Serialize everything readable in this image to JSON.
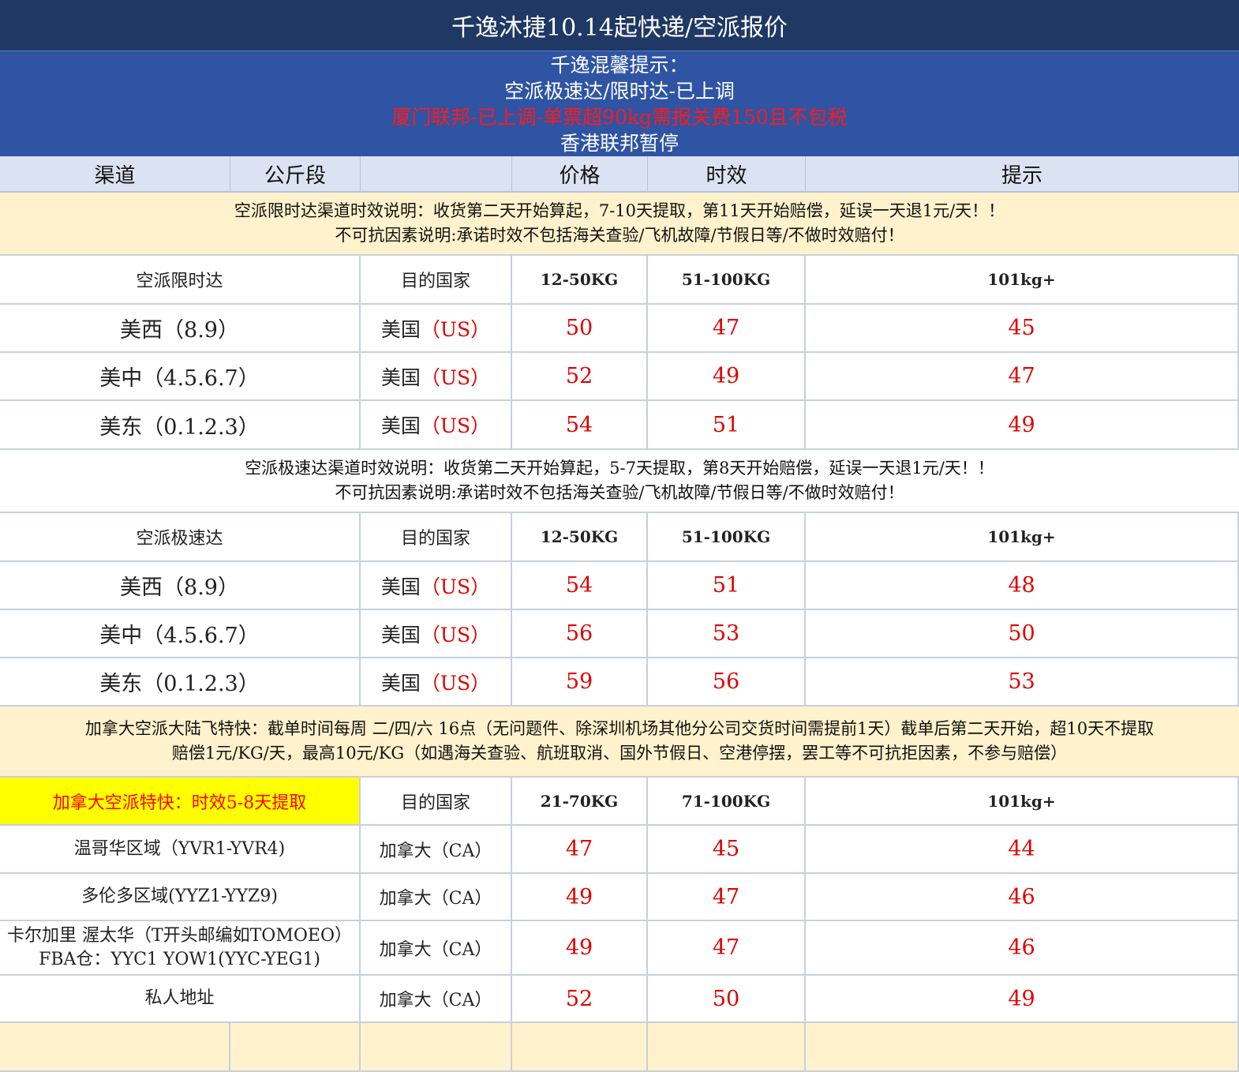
{
  "title": "千逸沐捷10.14起快递/空派报价",
  "notice": {
    "line1": "千逸混馨提示：",
    "line2": "空派极速达/限时达-已上调",
    "line3": "厦门联邦-已上调-单票超90kg需报关费150且不包税",
    "line4": "香港联邦暂停",
    "alert_color": "#ff1a1a"
  },
  "header": {
    "channel": "渠道",
    "weight": "公斤段",
    "price": "价格",
    "timeliness": "时效",
    "tips": "提示"
  },
  "sections": [
    {
      "note1": "空派限时达渠道时效说明：收货第二天开始算起，7-10天提取，第11天开始赔偿，延误一天退1元/天！！",
      "note2": "不可抗因素说明:承诺时效不包括海关查验/飞机故障/节假日等/不做时效赔付！",
      "sub": [
        "空派限时达",
        "目的国家",
        "12-50KG",
        "51-100KG",
        "101kg+"
      ],
      "rows": [
        {
          "name": "美西（8.9）",
          "country": "美国",
          "code": "（US）",
          "p1": "50",
          "p2": "47",
          "p3": "45"
        },
        {
          "name": "美中（4.5.6.7）",
          "country": "美国",
          "code": "（US）",
          "p1": "52",
          "p2": "49",
          "p3": "47"
        },
        {
          "name": "美东（0.1.2.3）",
          "country": "美国",
          "code": "（US）",
          "p1": "54",
          "p2": "51",
          "p3": "49"
        }
      ]
    },
    {
      "note1": "空派极速达渠道时效说明：收货第二天开始算起，5-7天提取，第8天开始赔偿，延误一天退1元/天！！",
      "note2": "不可抗因素说明:承诺时效不包括海关查验/飞机故障/节假日等/不做时效赔付！",
      "sub": [
        "空派极速达",
        "目的国家",
        "12-50KG",
        "51-100KG",
        "101kg+"
      ],
      "rows": [
        {
          "name": "美西（8.9）",
          "country": "美国",
          "code": "（US）",
          "p1": "54",
          "p2": "51",
          "p3": "48"
        },
        {
          "name": "美中（4.5.6.7）",
          "country": "美国",
          "code": "（US）",
          "p1": "56",
          "p2": "53",
          "p3": "50"
        },
        {
          "name": "美东（0.1.2.3）",
          "country": "美国",
          "code": "（US）",
          "p1": "59",
          "p2": "56",
          "p3": "53"
        }
      ]
    },
    {
      "note1": "加拿大空派大陆飞特快：截单时间每周 二/四/六 16点（无问题件、除深圳机场其他分公司交货时间需提前1天）截单后第二天开始，超10天不提取",
      "note2": "赔偿1元/KG/天，最高10元/KG（如遇海关查验、航班取消、国外节假日、空港停摆，罢工等不可抗拒因素，不参与赔偿）",
      "sub": [
        "加拿大空派特快：时效5-8天提取",
        "目的国家",
        "21-70KG",
        "71-100KG",
        "101kg+"
      ],
      "rows": [
        {
          "name": "温哥华区域（YVR1-YVR4)",
          "name2": "",
          "country": "加拿大（CA）",
          "p1": "47",
          "p2": "45",
          "p3": "44"
        },
        {
          "name": "多伦多区域(YYZ1-YYZ9)",
          "name2": "",
          "country": "加拿大（CA）",
          "p1": "49",
          "p2": "47",
          "p3": "46"
        },
        {
          "name": "卡尔加里 渥太华（T开头邮编如TOMOEO）",
          "name2": "FBA仓：YYC1 YOW1(YYC-YEG1)",
          "country": "加拿大（CA）",
          "p1": "49",
          "p2": "47",
          "p3": "46"
        },
        {
          "name": "私人地址",
          "name2": "",
          "country": "加拿大（CA）",
          "p1": "52",
          "p2": "50",
          "p3": "49"
        }
      ]
    }
  ],
  "colors": {
    "title_bg": "#1f3864",
    "notice_bg": "#2f54a4",
    "header_bg": "#dbe3f2",
    "note_bg": "#fff2cc",
    "highlight_bg": "#ffff00",
    "price_color": "#e00000"
  }
}
